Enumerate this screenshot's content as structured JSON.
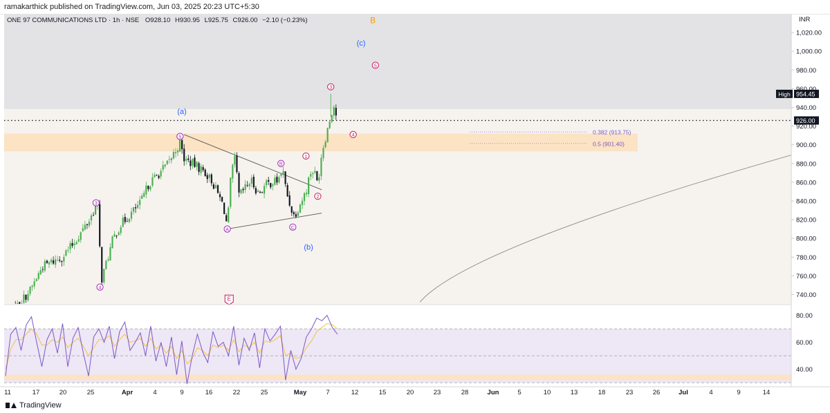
{
  "header": {
    "publisher": "ramakarthick published on TradingView.com, Jun 03, 2025 20:23 UTC+5:30"
  },
  "footer": {
    "brand": "TradingView"
  },
  "symbol_line": {
    "name": "ONE 97 COMMUNICATIONS LTD · 1h · NSE",
    "open": "O928.10",
    "high": "H930.95",
    "low": "L925.75",
    "close": "C926.00",
    "change": "−2.10 (−0.23%)"
  },
  "currency": "INR",
  "colors": {
    "up": "#4caf50",
    "down": "#131722",
    "rsi": "#7e57c2",
    "rsi_ma": "#f5c242",
    "fib_zone": "#fbe3c4",
    "wave_blue": "#2962ff",
    "wave_magenta": "#c2185b",
    "wave_purple": "#9c27b0",
    "wave_orange": "#ff9800"
  },
  "chart_data": [
    {
      "type": "candlestick",
      "ylim": [
        730,
        1040
      ],
      "y_ticks": [
        "740.00",
        "760.00",
        "780.00",
        "800.00",
        "820.00",
        "840.00",
        "860.00",
        "880.00",
        "900.00",
        "920.00",
        "940.00",
        "960.00",
        "980.00",
        "1,000.00",
        "1,020.00"
      ],
      "x_ticks": [
        "11",
        "17",
        "20",
        "25",
        "Apr",
        "4",
        "9",
        "16",
        "22",
        "25",
        "May",
        "7",
        "12",
        "15",
        "20",
        "23",
        "28",
        "Jun",
        "5",
        "10",
        "13",
        "18",
        "23",
        "26",
        "Jul",
        "4",
        "9",
        "14"
      ],
      "price_labels": {
        "high_label": "High",
        "high_value": "954.45",
        "last_value": "926.00"
      },
      "fib_levels": [
        {
          "label": "0.382 (913.75)",
          "value": 913.75
        },
        {
          "label": "0.5 (901.40)",
          "value": 901.4
        }
      ],
      "close_path": [
        [
          "2025-03-11",
          715
        ],
        [
          "2025-03-17",
          745
        ],
        [
          "2025-03-20",
          770
        ],
        [
          "2025-03-25",
          780
        ],
        [
          "2025-03-28",
          795
        ],
        [
          "2025-04-01",
          820
        ],
        [
          "2025-04-03",
          838
        ],
        [
          "2025-04-04",
          755
        ],
        [
          "2025-04-07",
          800
        ],
        [
          "2025-04-09",
          815
        ],
        [
          "2025-04-14",
          838
        ],
        [
          "2025-04-16",
          858
        ],
        [
          "2025-04-21",
          880
        ],
        [
          "2025-04-22",
          888
        ],
        [
          "2025-04-24",
          902
        ],
        [
          "2025-04-25",
          885
        ],
        [
          "2025-04-28",
          878
        ],
        [
          "2025-04-30",
          872
        ],
        [
          "2025-05-02",
          862
        ],
        [
          "2025-05-05",
          835
        ],
        [
          "2025-05-06",
          812
        ],
        [
          "2025-05-07",
          870
        ],
        [
          "2025-05-08",
          885
        ],
        [
          "2025-05-09",
          845
        ],
        [
          "2025-05-12",
          862
        ],
        [
          "2025-05-14",
          848
        ],
        [
          "2025-05-16",
          858
        ],
        [
          "2025-05-19",
          862
        ],
        [
          "2025-05-20",
          875
        ],
        [
          "2025-05-21",
          850
        ],
        [
          "2025-05-22",
          835
        ],
        [
          "2025-05-23",
          824
        ],
        [
          "2025-05-26",
          850
        ],
        [
          "2025-05-27",
          870
        ],
        [
          "2025-05-28",
          873
        ],
        [
          "2025-05-29",
          858
        ],
        [
          "2025-05-30",
          892
        ],
        [
          "2025-06-02",
          943
        ],
        [
          "2025-06-03",
          926
        ]
      ],
      "annotations": [
        {
          "label": "(a)",
          "value": 936,
          "color_key": "wave_blue",
          "kind": "text"
        },
        {
          "label": "(b)",
          "value": 791,
          "color_key": "wave_blue",
          "kind": "text"
        },
        {
          "label": "(c)",
          "value": 1009,
          "color_key": "wave_blue",
          "kind": "text"
        },
        {
          "label": "B",
          "value": 1033,
          "color_key": "wave_orange",
          "kind": "text"
        },
        {
          "label": "3",
          "value": 838,
          "color_key": "wave_purple",
          "kind": "circle"
        },
        {
          "label": "4",
          "value": 748,
          "color_key": "wave_purple",
          "kind": "circle"
        },
        {
          "label": "5",
          "value": 909,
          "color_key": "wave_purple",
          "kind": "circle"
        },
        {
          "label": "A",
          "value": 810,
          "color_key": "wave_purple",
          "kind": "circle"
        },
        {
          "label": "B",
          "value": 880,
          "color_key": "wave_purple",
          "kind": "circle"
        },
        {
          "label": "C",
          "value": 812,
          "color_key": "wave_purple",
          "kind": "circle"
        },
        {
          "label": "1",
          "value": 888,
          "color_key": "wave_magenta",
          "kind": "circle"
        },
        {
          "label": "2",
          "value": 845,
          "color_key": "wave_magenta",
          "kind": "circle"
        },
        {
          "label": "3",
          "value": 962,
          "color_key": "wave_magenta",
          "kind": "circle"
        },
        {
          "label": "4",
          "value": 911,
          "color_key": "wave_magenta",
          "kind": "circle"
        },
        {
          "label": "5",
          "value": 985,
          "color_key": "wave_magenta",
          "kind": "circle"
        },
        {
          "label": "E",
          "value": 735,
          "color_key": "wave_magenta",
          "kind": "flag"
        }
      ]
    },
    {
      "type": "line",
      "name": "",
      "ylim": [
        27,
        87
      ],
      "y_ticks": [
        "40.00",
        "60.00",
        "80.00"
      ],
      "band_lines": [
        30,
        50,
        70
      ],
      "series_rsi": [
        35,
        66,
        71,
        54,
        73,
        79,
        60,
        42,
        62,
        70,
        52,
        74,
        42,
        63,
        71,
        52,
        35,
        64,
        70,
        60,
        72,
        48,
        68,
        75,
        54,
        60,
        67,
        50,
        72,
        46,
        60,
        42,
        64,
        36,
        61,
        29,
        50,
        66,
        53,
        45,
        68,
        57,
        60,
        50,
        72,
        43,
        63,
        54,
        67,
        41,
        70,
        61,
        66,
        72,
        32,
        54,
        40,
        48,
        64,
        70,
        78,
        76,
        80,
        71,
        66
      ],
      "series_ma": [
        40,
        55,
        62,
        62,
        66,
        70,
        66,
        58,
        58,
        62,
        60,
        64,
        56,
        60,
        63,
        57,
        50,
        56,
        62,
        62,
        65,
        57,
        62,
        66,
        60,
        61,
        63,
        57,
        63,
        55,
        58,
        52,
        57,
        48,
        54,
        44,
        48,
        56,
        54,
        50,
        58,
        56,
        58,
        54,
        62,
        53,
        58,
        56,
        60,
        52,
        61,
        60,
        62,
        65,
        50,
        52,
        48,
        49,
        56,
        61,
        68,
        71,
        74,
        73,
        70
      ]
    }
  ]
}
